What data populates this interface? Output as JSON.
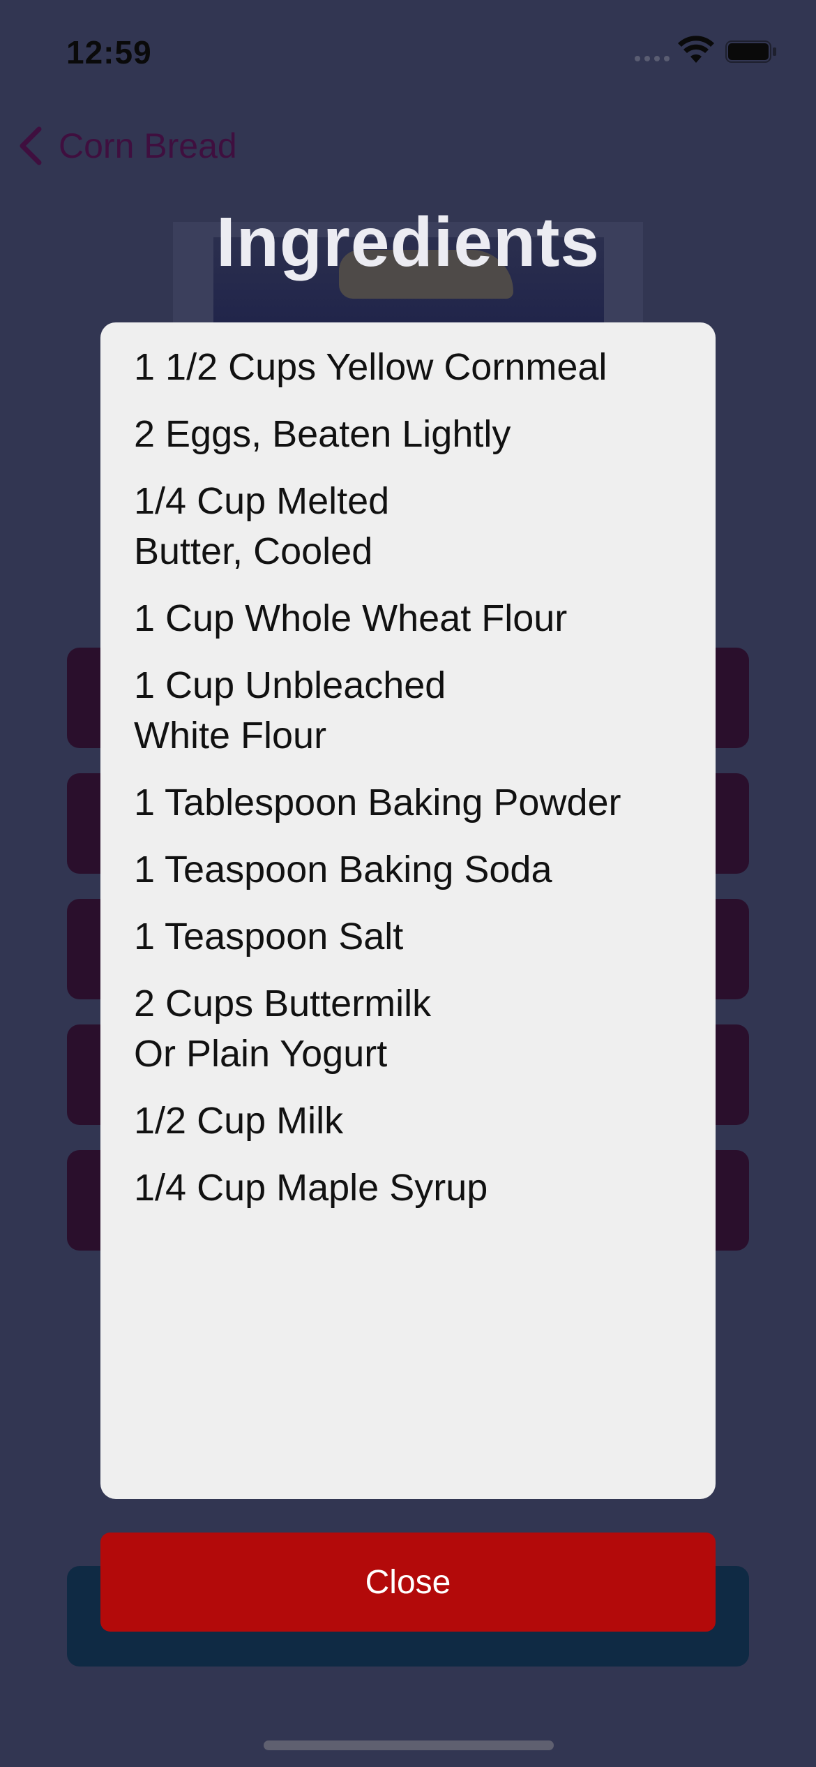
{
  "status_bar": {
    "time": "12:59"
  },
  "nav": {
    "back_label": "Corn Bread"
  },
  "page": {
    "title": "Ingredients"
  },
  "ingredients": [
    "1 1/2 Cups Yellow Cornmeal",
    "2 Eggs, Beaten Lightly",
    "1/4 Cup Melted Butter, Cooled",
    "1 Cup Whole Wheat Flour",
    "1 Cup Unbleached White Flour",
    "1 Tablespoon Baking Powder",
    "1 Teaspoon Baking Soda",
    "1 Teaspoon Salt",
    "2 Cups Buttermilk Or Plain Yogurt",
    "1/2 Cup Milk",
    "1/4 Cup Maple Syrup"
  ],
  "modal": {
    "close_label": "Close"
  },
  "colors": {
    "background": "#323652",
    "modal": "#efefef",
    "close_button": "#b30a0a",
    "nav_accent": "#3f0f3f",
    "bg_buttons": "#2a0f2c"
  },
  "icons": {
    "back": "chevron-left-icon",
    "wifi": "wifi-icon",
    "battery": "battery-icon",
    "signal": "signal-icon"
  }
}
